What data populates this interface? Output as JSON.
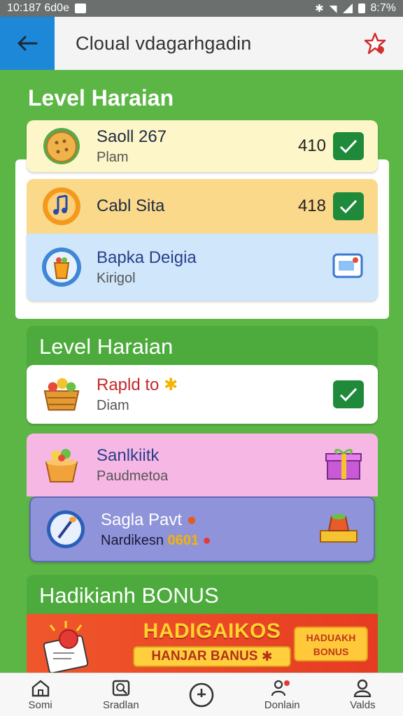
{
  "status_bar": {
    "time": "10:187 6d0e",
    "battery": "8:7%"
  },
  "app_bar": {
    "title": "Cloual vdagarhgadin",
    "back_icon": "arrow-left-icon",
    "action_icon": "star-icon"
  },
  "sections": [
    {
      "title": "Level Haraian"
    },
    {
      "title": "Level Haraian"
    },
    {
      "title": "Hadikianh BONUS"
    }
  ],
  "group1": [
    {
      "name": "Saoll 267",
      "sub": "Plam",
      "num": "410",
      "checked": true,
      "icon": "cookie-icon",
      "bg": "#fdf6c8"
    },
    {
      "name": "Cabl Sita",
      "sub": "",
      "num": "418",
      "checked": true,
      "icon": "music-note-icon",
      "bg": "#fbd98a"
    },
    {
      "name": "Bapka Deigia",
      "sub": "Kirigol",
      "num": "",
      "checked": false,
      "icon": "drink-cup-icon",
      "bg": "#cfe6fb",
      "right_icon": "ticket-icon"
    }
  ],
  "group2": [
    {
      "name": "Rapld to",
      "sub": "Diam",
      "checked": true,
      "icon": "fruit-basket-icon",
      "bg": "#ffffff",
      "name_color": "#c62828"
    },
    {
      "name": "Sanlkiitk",
      "sub": "Paudmetoa",
      "checked": false,
      "icon": "popcorn-icon",
      "bg": "#f7b7e4",
      "right_icon": "gift-box-icon"
    },
    {
      "name": "Sagla Pavt",
      "sub": "Nardikesn",
      "value": "0601",
      "checked": false,
      "icon": "brush-icon",
      "bg": "#8f93d9",
      "right_icon": "treasure-icon"
    }
  ],
  "banner": {
    "title": "HADIGAIKOS",
    "button": "HANJAR BANUS",
    "badge_line1": "HADUAKH",
    "badge_line2": "BONUS"
  },
  "nav": [
    {
      "label": "Somi",
      "icon": "home-icon"
    },
    {
      "label": "Sradlan",
      "icon": "search-icon"
    },
    {
      "label": "",
      "icon": "compass-icon"
    },
    {
      "label": "Donlain",
      "icon": "people-icon"
    },
    {
      "label": "Valds",
      "icon": "user-icon"
    }
  ],
  "colors": {
    "green": "#5cb646",
    "header_blue": "#1e88d8",
    "check_green": "#1e8a3a"
  }
}
